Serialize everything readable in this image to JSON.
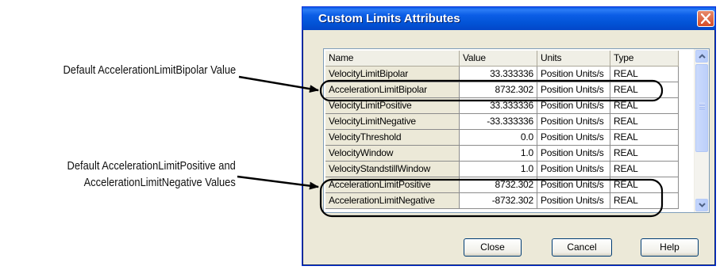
{
  "callouts": {
    "bipolar": "Default AccelerationLimitBipolar Value",
    "pos_neg_line1": "Default AccelerationLimitPositive and",
    "pos_neg_line2": "AccelerationLimitNegative Values"
  },
  "dialog": {
    "title": "Custom Limits Attributes",
    "columns": {
      "name": "Name",
      "value": "Value",
      "units": "Units",
      "type": "Type"
    },
    "rows": [
      {
        "name": "VelocityLimitBipolar",
        "value": "33.333336",
        "units": "Position Units/s",
        "type": "REAL"
      },
      {
        "name": "AccelerationLimitBipolar",
        "value": "8732.302",
        "units": "Position Units/s",
        "type": "REAL"
      },
      {
        "name": "VelocityLimitPositive",
        "value": "33.333336",
        "units": "Position Units/s",
        "type": "REAL"
      },
      {
        "name": "VelocityLimitNegative",
        "value": "-33.333336",
        "units": "Position Units/s",
        "type": "REAL"
      },
      {
        "name": "VelocityThreshold",
        "value": "0.0",
        "units": "Position Units/s",
        "type": "REAL"
      },
      {
        "name": "VelocityWindow",
        "value": "1.0",
        "units": "Position Units/s",
        "type": "REAL"
      },
      {
        "name": "VelocityStandstillWindow",
        "value": "1.0",
        "units": "Position Units/s",
        "type": "REAL"
      },
      {
        "name": "AccelerationLimitPositive",
        "value": "8732.302",
        "units": "Position Units/s",
        "type": "REAL"
      },
      {
        "name": "AccelerationLimitNegative",
        "value": "-8732.302",
        "units": "Position Units/s",
        "type": "REAL"
      }
    ],
    "buttons": {
      "close": "Close",
      "cancel": "Cancel",
      "help": "Help"
    }
  },
  "colors": {
    "titlebar": "#0253d6",
    "dialog_bg": "#ece9d8",
    "name_cell_bg": "#ece9d8",
    "highlight_ring": "#000000"
  },
  "icons": {
    "window_close": "close-icon",
    "scroll_up": "scroll-up-icon",
    "scroll_down": "scroll-down-icon"
  }
}
